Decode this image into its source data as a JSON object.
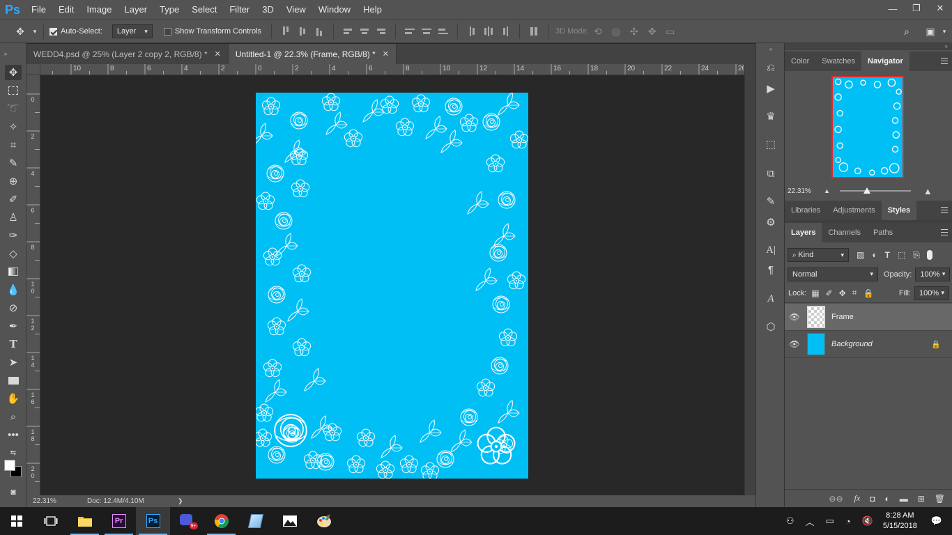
{
  "app": {
    "logo": "Ps",
    "menu": [
      "File",
      "Edit",
      "Image",
      "Layer",
      "Type",
      "Select",
      "Filter",
      "3D",
      "View",
      "Window",
      "Help"
    ],
    "window_controls": [
      "—",
      "❐",
      "✕"
    ]
  },
  "options_bar": {
    "auto_select_label": "Auto-Select:",
    "auto_select_checked": true,
    "auto_select_target": "Layer",
    "show_transform_label": "Show Transform Controls",
    "show_transform_checked": false,
    "mode_3d_label": "3D Mode:"
  },
  "tabs": [
    {
      "label": "WEDD4.psd @ 25% (Layer 2 copy 2, RGB/8) *",
      "close": "✕",
      "active": false
    },
    {
      "label": "Untitled-1 @ 22.3% (Frame, RGB/8) *",
      "close": "✕",
      "active": true
    }
  ],
  "ruler_top": [
    "10",
    "8",
    "6",
    "4",
    "2",
    "0",
    "2",
    "4",
    "6",
    "8",
    "10",
    "12",
    "14",
    "16",
    "18",
    "20",
    "22",
    "24",
    "26"
  ],
  "ruler_left": [
    "0",
    "2",
    "4",
    "6",
    "8",
    "10",
    "12",
    "14",
    "16",
    "18",
    "20"
  ],
  "status": {
    "zoom": "22.31%",
    "doc": "Doc: 12.4M/4.10M",
    "arrow": "❯"
  },
  "panels": {
    "top_tabs": [
      "Color",
      "Swatches",
      "Navigator"
    ],
    "navigator_zoom": "22.31%",
    "mid_tabs": [
      "Libraries",
      "Adjustments",
      "Styles"
    ],
    "layer_tabs": [
      "Layers",
      "Channels",
      "Paths"
    ],
    "kind_label": "Kind",
    "blend_mode": "Normal",
    "opacity_label": "Opacity:",
    "opacity_value": "100%",
    "lock_label": "Lock:",
    "fill_label": "Fill:",
    "fill_value": "100%",
    "layers": [
      {
        "name": "Frame",
        "selected": true,
        "type": "transparent"
      },
      {
        "name": "Background",
        "selected": false,
        "type": "fill",
        "locked": true
      }
    ]
  },
  "colors": {
    "accent": "#31a8ff",
    "artboard": "#00bff5",
    "navigator_frame": "#e0292d"
  },
  "taskbar": {
    "apps": [
      "file-explorer",
      "premiere-pro",
      "photoshop",
      "chat-app",
      "chrome",
      "notes-app",
      "photos",
      "paint"
    ],
    "time": "8:28 AM",
    "date": "5/15/2018"
  }
}
